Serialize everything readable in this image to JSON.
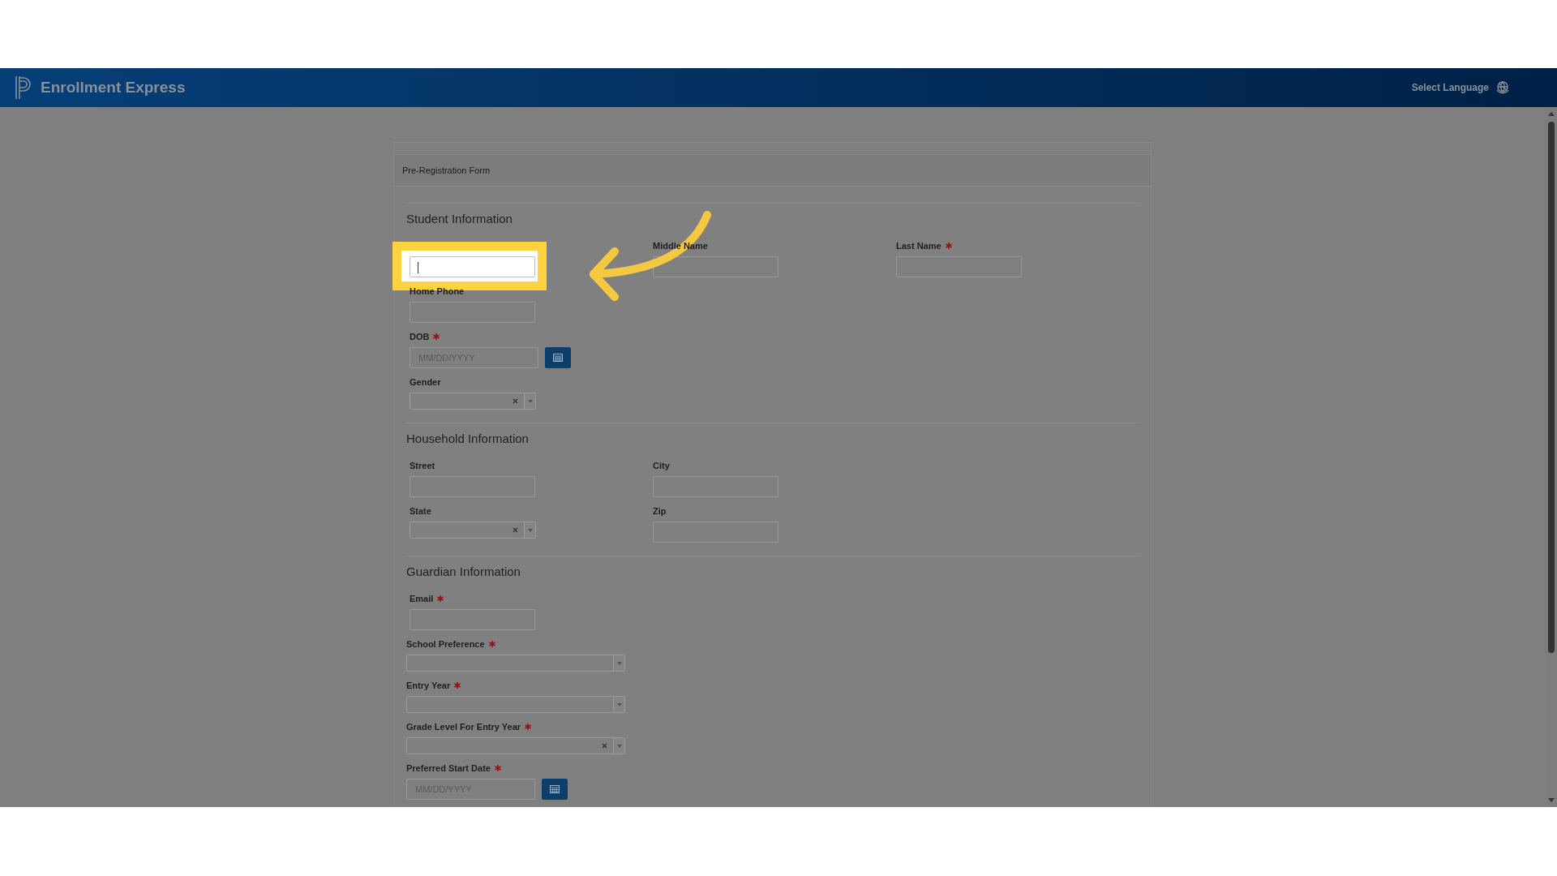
{
  "header": {
    "title": "Enrollment Express",
    "language_link": "Select Language"
  },
  "form": {
    "title": "Pre-Registration Form",
    "sections": [
      {
        "title": "Student Information",
        "rows": [
          [
            {
              "kind": "text",
              "focused": true
            },
            {
              "kind": "text",
              "label": "Middle Name",
              "required": false
            },
            {
              "kind": "text",
              "label": "Last Name",
              "required": true
            }
          ],
          [
            {
              "kind": "text",
              "label": "Home Phone",
              "required": false
            }
          ],
          [
            {
              "kind": "date",
              "label": "DOB",
              "required": true,
              "placeholder": "MM/DD/YYYY"
            }
          ],
          [
            {
              "kind": "select",
              "label": "Gender",
              "required": false,
              "clearable": true
            }
          ]
        ]
      },
      {
        "title": "Household Information",
        "rows": [
          [
            {
              "kind": "text",
              "label": "Street",
              "required": false
            },
            {
              "kind": "text",
              "label": "City",
              "required": false
            }
          ],
          [
            {
              "kind": "select",
              "label": "State",
              "required": false,
              "clearable": true
            },
            {
              "kind": "text",
              "label": "Zip",
              "required": false
            }
          ]
        ]
      },
      {
        "title": "Guardian Information",
        "rows": [
          [
            {
              "kind": "text",
              "label": "Email",
              "required": true
            }
          ],
          [
            {
              "kind": "wide-select",
              "label": "School Preference",
              "required": true,
              "clearable": false
            }
          ],
          [
            {
              "kind": "wide-select",
              "label": "Entry Year",
              "required": true,
              "clearable": false
            }
          ],
          [
            {
              "kind": "wide-select",
              "label": "Grade Level For Entry Year",
              "required": true,
              "clearable": true
            }
          ],
          [
            {
              "kind": "wide-date",
              "label": "Preferred Start Date",
              "required": true,
              "placeholder": "MM/DD/YYYY"
            }
          ]
        ]
      }
    ]
  }
}
